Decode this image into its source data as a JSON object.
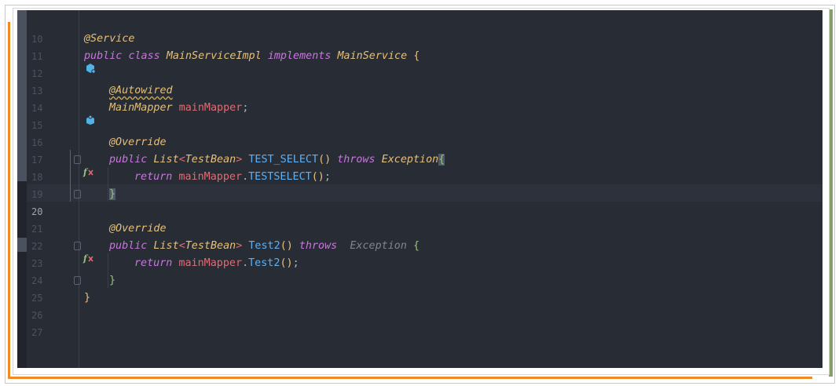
{
  "editor": {
    "language": "Java",
    "theme_colors": {
      "background": "#282c34",
      "keyword": "#c678dd",
      "annotation": "#e5c07b",
      "type": "#e5c07b",
      "field": "#e06c75",
      "method": "#61afef",
      "line_number": "#4b5263"
    },
    "current_line": 20,
    "lines": [
      {
        "n": "10"
      },
      {
        "n": "11",
        "t1": "@Service"
      },
      {
        "n": "12",
        "icon": "spring-bean-icon",
        "t1": "public",
        "t2": "class",
        "t3": "MainServiceImpl",
        "t4": "implements",
        "t5": "MainService",
        "t6": "{"
      },
      {
        "n": "13"
      },
      {
        "n": "14",
        "t1": "@Autowired"
      },
      {
        "n": "15",
        "icon": "autowired-bean-icon",
        "t1": "MainMapper",
        "t2": "mainMapper",
        "t3": ";"
      },
      {
        "n": "16"
      },
      {
        "n": "17",
        "t1": "@Override"
      },
      {
        "n": "18",
        "icon": "mybatis-method-icon",
        "t1": "public",
        "t2": "List",
        "t3": "<",
        "t4": "TestBean",
        "t5": ">",
        "t6": "TEST_SELECT",
        "t7": "()",
        "t8": "throws",
        "t9": "Exception",
        "t10": "{"
      },
      {
        "n": "19",
        "t1": "return",
        "t2": "mainMapper",
        "t3": ".",
        "t4": "TESTSELECT",
        "t5": "()",
        "t6": ";"
      },
      {
        "n": "20",
        "t1": "}"
      },
      {
        "n": "21"
      },
      {
        "n": "22",
        "t1": "@Override"
      },
      {
        "n": "23",
        "icon": "mybatis-method-icon",
        "t1": "public",
        "t2": "List",
        "t3": "<",
        "t4": "TestBean",
        "t5": ">",
        "t6": "Test2",
        "t7": "()",
        "t8": "throws",
        "t9": "Exception",
        "t10": "{"
      },
      {
        "n": "24",
        "t1": "return",
        "t2": "mainMapper",
        "t3": ".",
        "t4": "Test2",
        "t5": "()",
        "t6": ";"
      },
      {
        "n": "25",
        "t1": "}"
      },
      {
        "n": "26",
        "t1": "}"
      },
      {
        "n": "27"
      }
    ]
  }
}
